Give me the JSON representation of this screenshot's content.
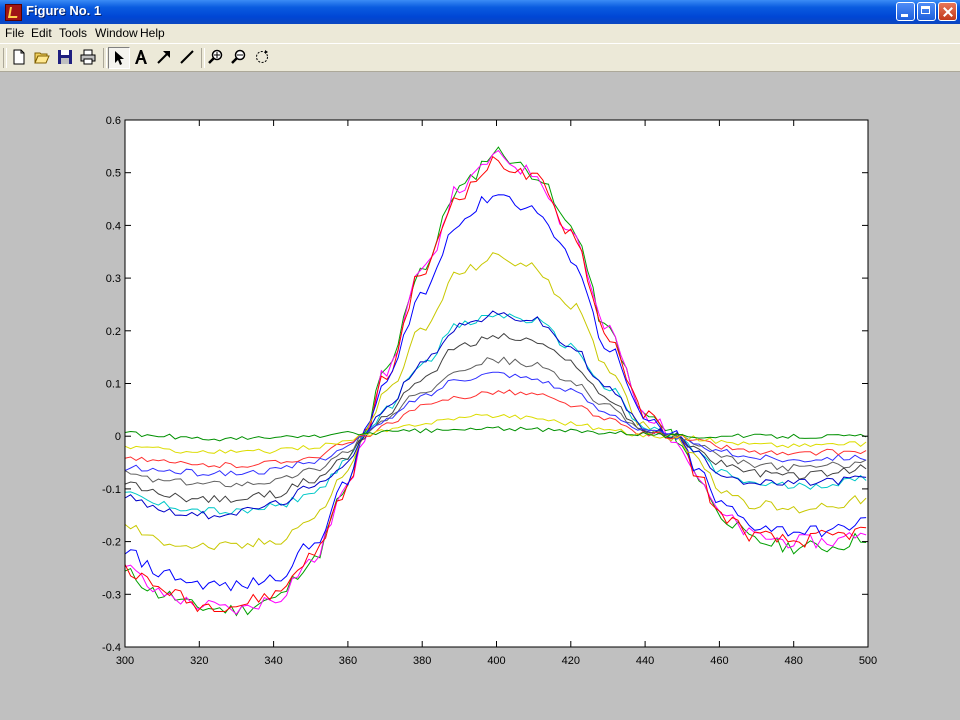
{
  "window": {
    "title": "Figure No. 1"
  },
  "menu": {
    "items": [
      "File",
      "Edit",
      "Tools",
      "Window",
      "Help"
    ]
  },
  "toolbar": {
    "buttons": [
      {
        "icon": "new-figure-icon"
      },
      {
        "icon": "open-file-icon"
      },
      {
        "icon": "save-icon"
      },
      {
        "icon": "print-icon"
      },
      {
        "icon": "edit-plot-arrow-icon",
        "pressed": true
      },
      {
        "icon": "insert-text-icon"
      },
      {
        "icon": "insert-arrow-icon"
      },
      {
        "icon": "insert-line-icon"
      },
      {
        "icon": "zoom-in-icon"
      },
      {
        "icon": "zoom-out-icon"
      },
      {
        "icon": "rotate-3d-icon"
      }
    ]
  },
  "chart_data": {
    "type": "line",
    "title": "",
    "xlabel": "",
    "ylabel": "",
    "xlim": [
      300,
      500
    ],
    "ylim": [
      -0.4,
      0.6
    ],
    "xticks": [
      300,
      320,
      340,
      360,
      380,
      400,
      420,
      440,
      460,
      480,
      500
    ],
    "yticks": [
      -0.4,
      -0.3,
      -0.2,
      -0.1,
      0,
      0.1,
      0.2,
      0.3,
      0.4,
      0.5,
      0.6
    ],
    "grid": false,
    "legend": "none",
    "x": [
      300,
      310,
      320,
      330,
      340,
      350,
      360,
      364,
      370,
      380,
      390,
      400,
      410,
      420,
      430,
      440,
      448,
      455,
      460,
      470,
      480,
      490,
      500
    ],
    "series": [
      {
        "color": "#00a000",
        "values": [
          -0.26,
          -0.3,
          -0.325,
          -0.33,
          -0.31,
          -0.24,
          -0.1,
          0.0,
          0.12,
          0.32,
          0.47,
          0.54,
          0.5,
          0.4,
          0.2,
          0.04,
          0.0,
          -0.08,
          -0.15,
          -0.2,
          -0.21,
          -0.21,
          -0.19
        ]
      },
      {
        "color": "#ff00ff",
        "values": [
          -0.25,
          -0.3,
          -0.32,
          -0.33,
          -0.31,
          -0.24,
          -0.1,
          0.0,
          0.12,
          0.31,
          0.47,
          0.53,
          0.5,
          0.39,
          0.2,
          0.04,
          0.0,
          -0.08,
          -0.15,
          -0.19,
          -0.2,
          -0.2,
          -0.18
        ]
      },
      {
        "color": "#ff0000",
        "values": [
          -0.25,
          -0.29,
          -0.32,
          -0.32,
          -0.3,
          -0.23,
          -0.1,
          0.0,
          0.11,
          0.31,
          0.46,
          0.52,
          0.49,
          0.39,
          0.19,
          0.04,
          0.0,
          -0.08,
          -0.15,
          -0.19,
          -0.2,
          -0.19,
          -0.18
        ]
      },
      {
        "color": "#0000ff",
        "values": [
          -0.22,
          -0.26,
          -0.28,
          -0.285,
          -0.27,
          -0.21,
          -0.09,
          0.0,
          0.1,
          0.27,
          0.41,
          0.46,
          0.43,
          0.34,
          0.17,
          0.03,
          0.0,
          -0.07,
          -0.13,
          -0.17,
          -0.18,
          -0.18,
          -0.16
        ]
      },
      {
        "color": "#c8c800",
        "values": [
          -0.17,
          -0.2,
          -0.21,
          -0.21,
          -0.2,
          -0.16,
          -0.07,
          0.0,
          0.08,
          0.2,
          0.31,
          0.34,
          0.32,
          0.25,
          0.13,
          0.02,
          0.0,
          -0.05,
          -0.1,
          -0.13,
          -0.14,
          -0.13,
          -0.12
        ]
      },
      {
        "color": "#00c8c8",
        "values": [
          -0.11,
          -0.13,
          -0.14,
          -0.145,
          -0.135,
          -0.11,
          -0.05,
          0.0,
          0.05,
          0.14,
          0.21,
          0.23,
          0.22,
          0.17,
          0.09,
          0.015,
          0.0,
          -0.035,
          -0.07,
          -0.09,
          -0.095,
          -0.09,
          -0.08
        ]
      },
      {
        "color": "#0000c8",
        "values": [
          -0.11,
          -0.14,
          -0.15,
          -0.145,
          -0.13,
          -0.1,
          -0.05,
          0.0,
          0.05,
          0.14,
          0.21,
          0.23,
          0.22,
          0.17,
          0.09,
          0.015,
          0.0,
          -0.035,
          -0.07,
          -0.09,
          -0.09,
          -0.085,
          -0.08
        ]
      },
      {
        "color": "#404040",
        "values": [
          -0.09,
          -0.11,
          -0.12,
          -0.12,
          -0.11,
          -0.085,
          -0.04,
          0.0,
          0.04,
          0.11,
          0.17,
          0.19,
          0.18,
          0.14,
          0.07,
          0.01,
          0.0,
          -0.03,
          -0.05,
          -0.07,
          -0.075,
          -0.07,
          -0.06
        ]
      },
      {
        "color": "#606060",
        "values": [
          -0.07,
          -0.085,
          -0.09,
          -0.09,
          -0.085,
          -0.065,
          -0.03,
          0.0,
          0.03,
          0.085,
          0.13,
          0.145,
          0.135,
          0.105,
          0.055,
          0.01,
          0.0,
          -0.02,
          -0.04,
          -0.055,
          -0.06,
          -0.055,
          -0.05
        ]
      },
      {
        "color": "#3030ff",
        "values": [
          -0.06,
          -0.065,
          -0.07,
          -0.07,
          -0.065,
          -0.05,
          -0.02,
          0.0,
          0.03,
          0.075,
          0.11,
          0.12,
          0.11,
          0.085,
          0.045,
          0.01,
          0.0,
          -0.02,
          -0.03,
          -0.04,
          -0.045,
          -0.04,
          -0.04
        ]
      },
      {
        "color": "#ff3030",
        "values": [
          -0.04,
          -0.05,
          -0.055,
          -0.055,
          -0.05,
          -0.04,
          -0.015,
          0.0,
          0.02,
          0.055,
          0.075,
          0.085,
          0.08,
          0.06,
          0.03,
          0.005,
          0.0,
          -0.01,
          -0.02,
          -0.03,
          -0.035,
          -0.03,
          -0.03
        ]
      },
      {
        "color": "#dcdc00",
        "values": [
          -0.02,
          -0.025,
          -0.03,
          -0.03,
          -0.028,
          -0.02,
          -0.01,
          0.0,
          0.01,
          0.025,
          0.035,
          0.04,
          0.035,
          0.025,
          0.012,
          0.002,
          0.0,
          -0.005,
          -0.01,
          -0.015,
          -0.018,
          -0.015,
          -0.015
        ]
      },
      {
        "color": "#009000",
        "values": [
          0.005,
          0.0,
          -0.005,
          -0.005,
          -0.003,
          0.0,
          0.005,
          0.005,
          0.008,
          0.01,
          0.012,
          0.015,
          0.012,
          0.01,
          0.008,
          0.005,
          0.0,
          0.0,
          0.0,
          0.0,
          0.0,
          0.0,
          0.0
        ]
      }
    ]
  }
}
